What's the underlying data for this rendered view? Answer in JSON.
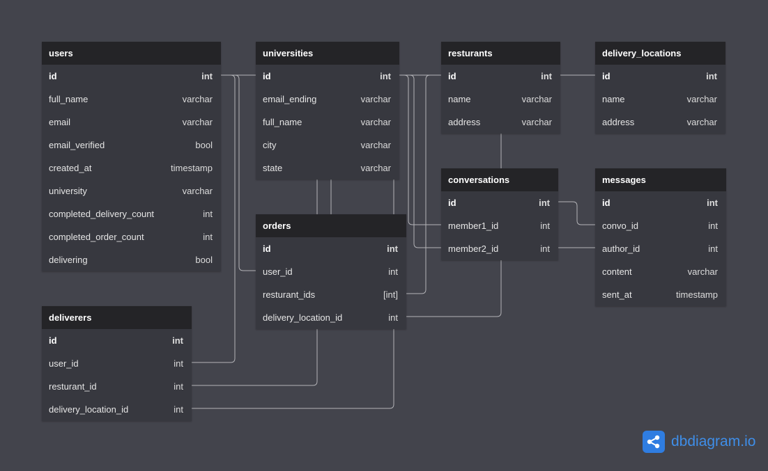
{
  "tables": [
    {
      "name": "users",
      "fields": [
        {
          "name": "id",
          "type": "int",
          "pk": true
        },
        {
          "name": "full_name",
          "type": "varchar"
        },
        {
          "name": "email",
          "type": "varchar"
        },
        {
          "name": "email_verified",
          "type": "bool"
        },
        {
          "name": "created_at",
          "type": "timestamp"
        },
        {
          "name": "university",
          "type": "varchar"
        },
        {
          "name": "completed_delivery_count",
          "type": "int"
        },
        {
          "name": "completed_order_count",
          "type": "int"
        },
        {
          "name": "delivering",
          "type": "bool"
        }
      ]
    },
    {
      "name": "universities",
      "fields": [
        {
          "name": "id",
          "type": "int",
          "pk": true
        },
        {
          "name": "email_ending",
          "type": "varchar"
        },
        {
          "name": "full_name",
          "type": "varchar"
        },
        {
          "name": "city",
          "type": "varchar"
        },
        {
          "name": "state",
          "type": "varchar"
        }
      ]
    },
    {
      "name": "resturants",
      "fields": [
        {
          "name": "id",
          "type": "int",
          "pk": true
        },
        {
          "name": "name",
          "type": "varchar"
        },
        {
          "name": "address",
          "type": "varchar"
        }
      ]
    },
    {
      "name": "delivery_locations",
      "fields": [
        {
          "name": "id",
          "type": "int",
          "pk": true
        },
        {
          "name": "name",
          "type": "varchar"
        },
        {
          "name": "address",
          "type": "varchar"
        }
      ]
    },
    {
      "name": "conversations",
      "fields": [
        {
          "name": "id",
          "type": "int",
          "pk": true
        },
        {
          "name": "member1_id",
          "type": "int"
        },
        {
          "name": "member2_id",
          "type": "int"
        }
      ]
    },
    {
      "name": "messages",
      "fields": [
        {
          "name": "id",
          "type": "int",
          "pk": true
        },
        {
          "name": "convo_id",
          "type": "int"
        },
        {
          "name": "author_id",
          "type": "int"
        },
        {
          "name": "content",
          "type": "varchar"
        },
        {
          "name": "sent_at",
          "type": "timestamp"
        }
      ]
    },
    {
      "name": "orders",
      "fields": [
        {
          "name": "id",
          "type": "int",
          "pk": true
        },
        {
          "name": "user_id",
          "type": "int"
        },
        {
          "name": "resturant_ids",
          "type": "[int]"
        },
        {
          "name": "delivery_location_id",
          "type": "int"
        }
      ]
    },
    {
      "name": "deliverers",
      "fields": [
        {
          "name": "id",
          "type": "int",
          "pk": true
        },
        {
          "name": "user_id",
          "type": "int"
        },
        {
          "name": "resturant_id",
          "type": "int"
        },
        {
          "name": "delivery_location_id",
          "type": "int"
        }
      ]
    }
  ],
  "brand": {
    "name": "dbdiagram",
    "suffix": ".io"
  },
  "colors": {
    "background": "#43444c",
    "table_body": "#37383f",
    "table_header": "#242427",
    "connector": "#b4b4b8",
    "brand": "#3f8ee8"
  }
}
